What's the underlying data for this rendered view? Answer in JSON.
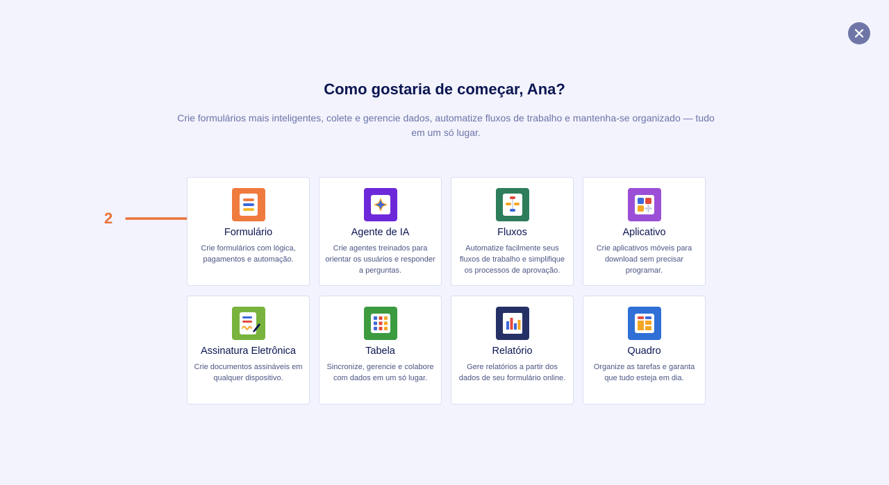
{
  "header": {
    "close_icon": "close-icon",
    "title": "Como gostaria de começar, Ana?",
    "subtitle": "Crie formulários mais inteligentes, colete e gerencie dados, automatize fluxos de trabalho e mantenha-se organizado — tudo em um só lugar."
  },
  "annotation": {
    "number": "2",
    "color": "#e8733a"
  },
  "cards": [
    {
      "title": "Formulário",
      "desc": "Crie formulários com lógica, pagamentos e automação.",
      "icon": "form-icon",
      "color": "#f07b3f"
    },
    {
      "title": "Agente de IA",
      "desc": "Crie agentes treinados para orientar os usuários e responder a perguntas.",
      "icon": "ai-agent-icon",
      "color": "#6d28d9"
    },
    {
      "title": "Fluxos",
      "desc": "Automatize facilmente seus fluxos de trabalho e simplifique os processos de aprovação.",
      "icon": "workflow-icon",
      "color": "#2e7d5b"
    },
    {
      "title": "Aplicativo",
      "desc": "Crie aplicativos móveis para download sem precisar programar.",
      "icon": "app-icon",
      "color": "#9b4fd6"
    },
    {
      "title": "Assinatura Eletrônica",
      "desc": "Crie documentos assináveis em qualquer dispositivo.",
      "icon": "e-signature-icon",
      "color": "#78b33d"
    },
    {
      "title": "Tabela",
      "desc": "Sincronize, gerencie e colabore com dados em um só lugar.",
      "icon": "table-icon",
      "color": "#3c9a3f"
    },
    {
      "title": "Relatório",
      "desc": "Gere relatórios a partir dos dados de seu formulário online.",
      "icon": "report-icon",
      "color": "#253166"
    },
    {
      "title": "Quadro",
      "desc": "Organize as tarefas e garanta que tudo esteja em dia.",
      "icon": "board-icon",
      "color": "#2f6fd6"
    }
  ]
}
